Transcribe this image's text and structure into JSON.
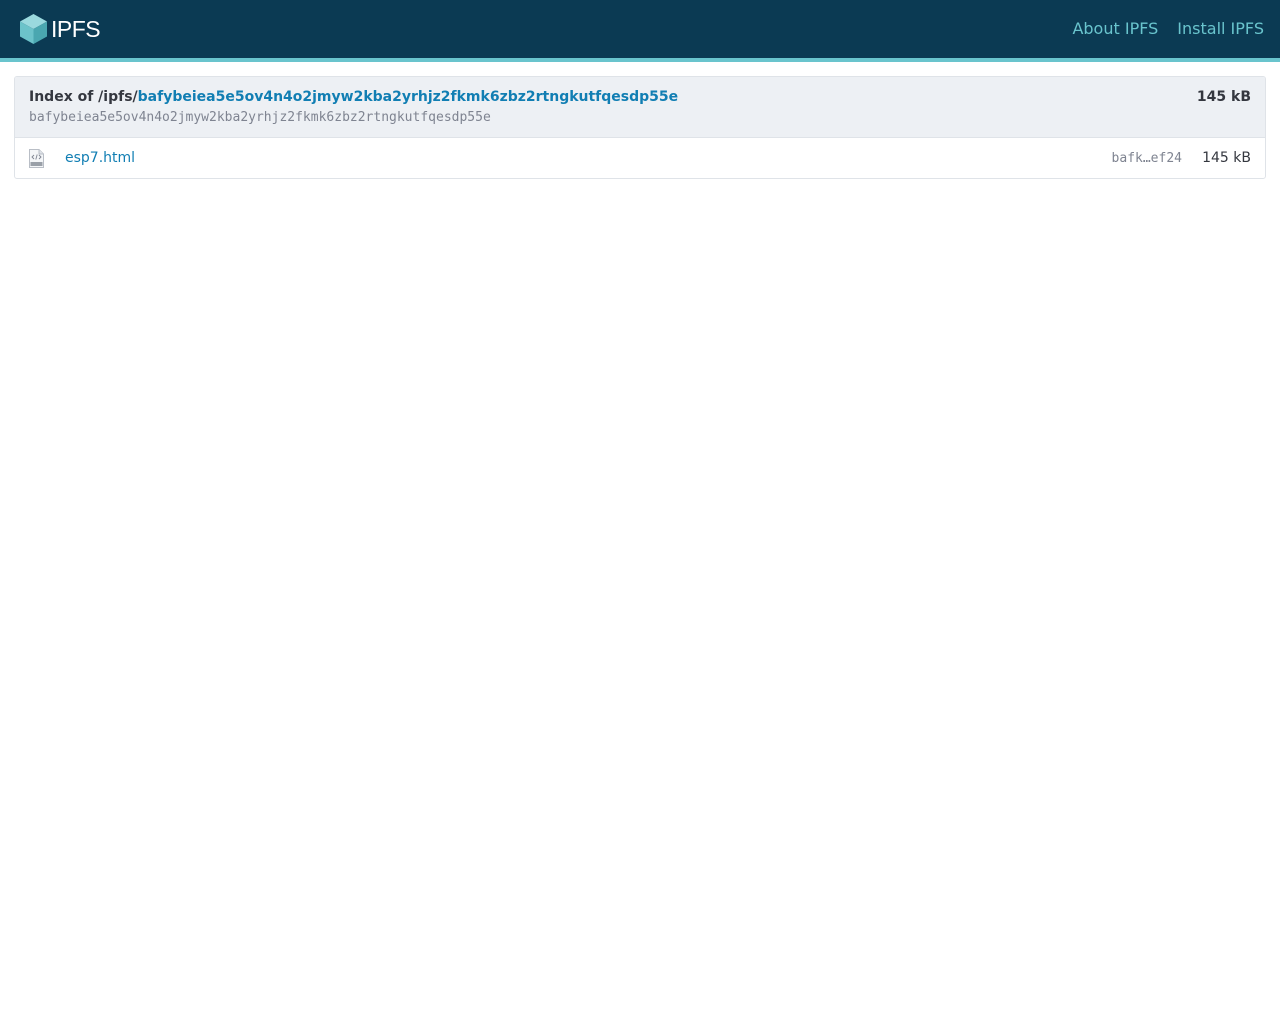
{
  "header": {
    "logo_icon": "ipfs-cube-icon",
    "logo_text": "IPFS",
    "nav": [
      {
        "label": "About IPFS"
      },
      {
        "label": "Install IPFS"
      }
    ],
    "colors": {
      "bar": "#0b3a53",
      "accent": "#69c4cd"
    }
  },
  "listing": {
    "index_prefix": "Index of /ipfs/",
    "root_cid": "bafybeiea5e5ov4n4o2jmyw2kba2yrhjz2fkmk6zbz2rtngkutfqesdp55e",
    "root_cid_plain": "bafybeiea5e5ov4n4o2jmyw2kba2yrhjz2fkmk6zbz2rtngkutfqesdp55e",
    "total_size": "145 kB",
    "files": [
      {
        "icon": "html-file-icon",
        "name": "esp7.html",
        "cid_short": "bafk…ef24",
        "size": "145 kB"
      }
    ]
  }
}
